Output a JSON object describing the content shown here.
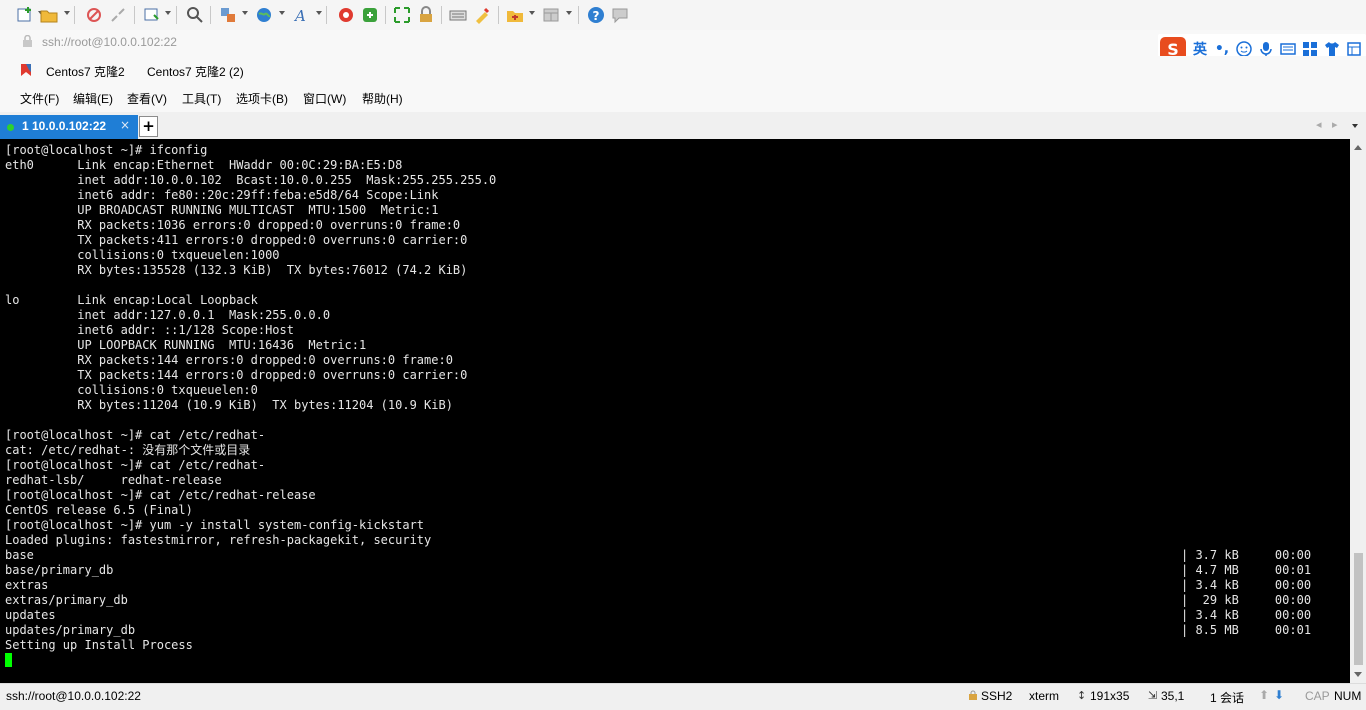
{
  "address": {
    "text": "ssh://root@10.0.0.102:22"
  },
  "links": [
    "Centos7 克隆2",
    "Centos7 克隆2 (2)"
  ],
  "menu": [
    "文件(F)",
    "编辑(E)",
    "查看(V)",
    "工具(T)",
    "选项卡(B)",
    "窗口(W)",
    "帮助(H)"
  ],
  "tab": {
    "label": "1 10.0.0.102:22",
    "close": "×",
    "add": "+"
  },
  "ime": {
    "s": "S",
    "lang": "英",
    "punct": "•,"
  },
  "terminal": {
    "lines": [
      "[root@localhost ~]# ifconfig",
      "eth0      Link encap:Ethernet  HWaddr 00:0C:29:BA:E5:D8  ",
      "          inet addr:10.0.0.102  Bcast:10.0.0.255  Mask:255.255.255.0",
      "          inet6 addr: fe80::20c:29ff:feba:e5d8/64 Scope:Link",
      "          UP BROADCAST RUNNING MULTICAST  MTU:1500  Metric:1",
      "          RX packets:1036 errors:0 dropped:0 overruns:0 frame:0",
      "          TX packets:411 errors:0 dropped:0 overruns:0 carrier:0",
      "          collisions:0 txqueuelen:1000 ",
      "          RX bytes:135528 (132.3 KiB)  TX bytes:76012 (74.2 KiB)",
      "",
      "lo        Link encap:Local Loopback  ",
      "          inet addr:127.0.0.1  Mask:255.0.0.0",
      "          inet6 addr: ::1/128 Scope:Host",
      "          UP LOOPBACK RUNNING  MTU:16436  Metric:1",
      "          RX packets:144 errors:0 dropped:0 overruns:0 frame:0",
      "          TX packets:144 errors:0 dropped:0 overruns:0 carrier:0",
      "          collisions:0 txqueuelen:0 ",
      "          RX bytes:11204 (10.9 KiB)  TX bytes:11204 (10.9 KiB)",
      "",
      "[root@localhost ~]# cat /etc/redhat-",
      "cat: /etc/redhat-: 没有那个文件或目录",
      "[root@localhost ~]# cat /etc/redhat-",
      "redhat-lsb/     redhat-release",
      "[root@localhost ~]# cat /etc/redhat-release ",
      "CentOS release 6.5 (Final)",
      "[root@localhost ~]# yum -y install system-config-kickstart",
      "Loaded plugins: fastestmirror, refresh-packagekit, security",
      "base",
      "base/primary_db",
      "extras",
      "extras/primary_db",
      "updates",
      "updates/primary_db",
      "Setting up Install Process"
    ],
    "progress": [
      "| 3.7 kB     00:00",
      "| 4.7 MB     00:01",
      "| 3.4 kB     00:00",
      "|  29 kB     00:00",
      "| 3.4 kB     00:00",
      "| 8.5 MB     00:01"
    ]
  },
  "status": {
    "connection": "ssh://root@10.0.0.102:22",
    "protocol": "SSH2",
    "term": "xterm",
    "size": "191x35",
    "pos": "35,1",
    "sessions": "1 会话",
    "cap": "CAP",
    "num": "NUM"
  },
  "colors": {
    "accent": "#1f7ed6",
    "terminal_bg": "#000000",
    "cursor": "#00ff00"
  }
}
